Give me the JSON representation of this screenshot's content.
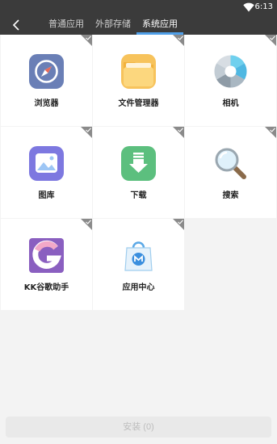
{
  "status": {
    "time": "6:13"
  },
  "tabs": [
    {
      "label": "普通应用"
    },
    {
      "label": "外部存储"
    },
    {
      "label": "系统应用"
    }
  ],
  "apps": [
    {
      "label": "浏览器",
      "icon": "compass-icon"
    },
    {
      "label": "文件管理器",
      "icon": "folder-icon"
    },
    {
      "label": "相机",
      "icon": "aperture-icon"
    },
    {
      "label": "图库",
      "icon": "gallery-icon"
    },
    {
      "label": "下载",
      "icon": "download-icon"
    },
    {
      "label": "搜索",
      "icon": "magnifier-icon"
    },
    {
      "label": "KK谷歌助手",
      "icon": "kk-google-icon"
    },
    {
      "label": "应用中心",
      "icon": "app-center-icon"
    }
  ],
  "install_button": {
    "label": "安装 (0)"
  },
  "colors": {
    "accent": "#4f9fe8",
    "header": "#3b3b3b"
  }
}
